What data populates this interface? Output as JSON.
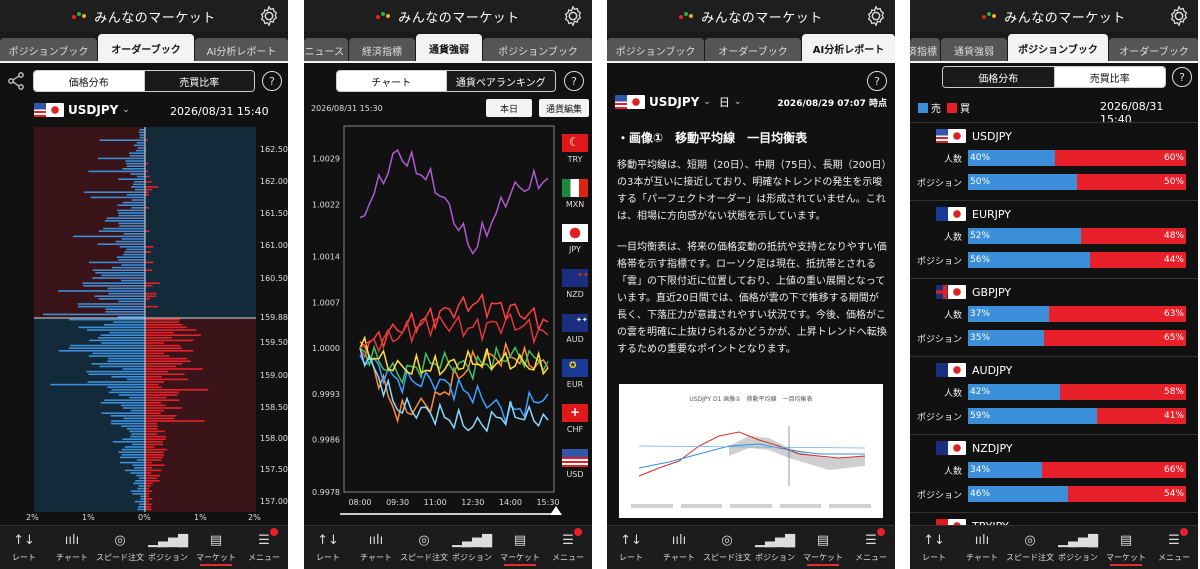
{
  "app": {
    "title": "みんなのマーケット"
  },
  "nav": {
    "items": [
      {
        "id": "rate",
        "label": "レート"
      },
      {
        "id": "chart",
        "label": "チャート"
      },
      {
        "id": "speed",
        "label": "スピード注文"
      },
      {
        "id": "position",
        "label": "ポジション"
      },
      {
        "id": "market",
        "label": "マーケット"
      },
      {
        "id": "menu",
        "label": "メニュー"
      }
    ]
  },
  "screen1": {
    "tabs": [
      "ポジションブック",
      "オーダーブック",
      "AI分析レポート"
    ],
    "active_tab": "オーダーブック",
    "segment": {
      "left": "価格分布",
      "right": "売買比率"
    },
    "help": "?",
    "pair": "USDJPY",
    "datetime": "2026/08/31 15:40",
    "price_labels": [
      "162.50",
      "162.00",
      "161.50",
      "161.00",
      "160.50",
      "159.88",
      "159.50",
      "159.00",
      "158.50",
      "158.00",
      "157.50",
      "157.00"
    ],
    "x_labels": [
      "2%",
      "1%",
      "0%",
      "1%",
      "2%"
    ]
  },
  "screen2": {
    "tabs": [
      "ニュース",
      "経済指標",
      "通貨強弱",
      "ポジションブック"
    ],
    "active_tab": "通貨強弱",
    "segment": {
      "left": "チャート",
      "right": "通貨ペアランキング"
    },
    "help": "?",
    "datetime": "2026/08/31 15:30",
    "btn_today": "本日",
    "btn_edit": "通貨編集",
    "currencies": [
      "TRY",
      "MXN",
      "JPY",
      "NZD",
      "AUD",
      "EUR",
      "CHF",
      "USD"
    ]
  },
  "chart_data": {
    "type": "line",
    "title": "",
    "x": [
      "08:00",
      "09:30",
      "11:00",
      "12:30",
      "14:00",
      "15:30"
    ],
    "ylim": [
      0.9978,
      1.0034
    ],
    "y_ticks": [
      "1.0029",
      "1.0022",
      "1.0014",
      "1.0007",
      "1.0000",
      "0.9993",
      "0.9986",
      "0.9978"
    ],
    "series": [
      {
        "name": "TRY",
        "color": "#ff4040",
        "values": [
          1.0,
          1.0003,
          1.0005,
          1.0007,
          1.0006,
          1.0004
        ]
      },
      {
        "name": "MXN",
        "color": "#b05ad0",
        "values": [
          1.002,
          1.003,
          1.0025,
          1.0015,
          1.0024,
          1.0026
        ]
      },
      {
        "name": "JPY",
        "color": "#ff8a3a",
        "values": [
          1.0001,
          0.999,
          0.9992,
          0.9998,
          0.9999,
          0.9997
        ]
      },
      {
        "name": "NZD",
        "color": "#3fa0ff",
        "values": [
          0.9999,
          0.9995,
          0.9995,
          0.9993,
          0.999,
          0.9993
        ]
      },
      {
        "name": "AUD",
        "color": "#40c060",
        "values": [
          1.0,
          0.9996,
          0.9998,
          0.9997,
          0.9999,
          0.9998
        ]
      },
      {
        "name": "EUR",
        "color": "#ffe040",
        "values": [
          1.0,
          0.9997,
          0.9997,
          0.9998,
          0.9998,
          0.9997
        ]
      },
      {
        "name": "CHF",
        "color": "#e03838",
        "values": [
          1.0,
          1.0002,
          1.0004,
          1.0003,
          1.0004,
          1.0002
        ]
      },
      {
        "name": "USD",
        "color": "#8ad8ff",
        "values": [
          1.0,
          0.9991,
          0.999,
          0.9988,
          0.999,
          0.9989
        ]
      }
    ]
  },
  "screen3": {
    "tabs": [
      "ポジションブック",
      "オーダーブック",
      "AI分析レポート"
    ],
    "active_tab": "AI分析レポート",
    "help": "?",
    "pair": "USDJPY",
    "timeframe": "日",
    "datetime": "2026/08/29 07:07 時点",
    "heading": "・画像①　移動平均線　一目均衡表",
    "para1": "移動平均線は、短期（20日）、中期（75日）、長期（200日）の3本が互いに接近しており、明確なトレンドの発生を示唆する「パーフェクトオーダー」は形成されていません。これは、相場に方向感がない状態を示しています。",
    "para2": "一目均衡表は、将来の価格変動の抵抗や支持となりやすい価格帯を示す指標です。ローソク足は現在、抵抗帯とされる「雲」の下限付近に位置しており、上値の重い展開となっています。直近20日間では、価格が雲の下で推移する期間が長く、下落圧力が意識されやすい状況です。今後、価格がこの雲を明確に上抜けられるかどうかが、上昇トレンドへ転換するための重要なポイントとなります。",
    "thumb_title": "USDJPY D1 画像①　移動平均線　一目均衡表"
  },
  "screen4": {
    "tabs": [
      "経済指標",
      "通貨強弱",
      "ポジションブック",
      "オーダーブック"
    ],
    "active_tab": "ポジションブック",
    "segment": {
      "left": "価格分布",
      "right": "売買比率"
    },
    "legend_sell": "売",
    "legend_buy": "買",
    "datetime": "2026/08/31 15:40",
    "row_label_people": "人数",
    "row_label_position": "ポジション",
    "pairs": [
      {
        "name": "USDJPY",
        "people_sell": "40%",
        "people_buy": "60%",
        "pos_sell": "50%",
        "pos_buy": "50%",
        "ps": 0.4,
        "qs": 0.5
      },
      {
        "name": "EURJPY",
        "people_sell": "52%",
        "people_buy": "48%",
        "pos_sell": "56%",
        "pos_buy": "44%",
        "ps": 0.52,
        "qs": 0.56
      },
      {
        "name": "GBPJPY",
        "people_sell": "37%",
        "people_buy": "63%",
        "pos_sell": "35%",
        "pos_buy": "65%",
        "ps": 0.37,
        "qs": 0.35
      },
      {
        "name": "AUDJPY",
        "people_sell": "42%",
        "people_buy": "58%",
        "pos_sell": "59%",
        "pos_buy": "41%",
        "ps": 0.42,
        "qs": 0.59
      },
      {
        "name": "NZDJPY",
        "people_sell": "34%",
        "people_buy": "66%",
        "pos_sell": "46%",
        "pos_buy": "54%",
        "ps": 0.34,
        "qs": 0.46
      },
      {
        "name": "TRYJPY"
      }
    ]
  }
}
